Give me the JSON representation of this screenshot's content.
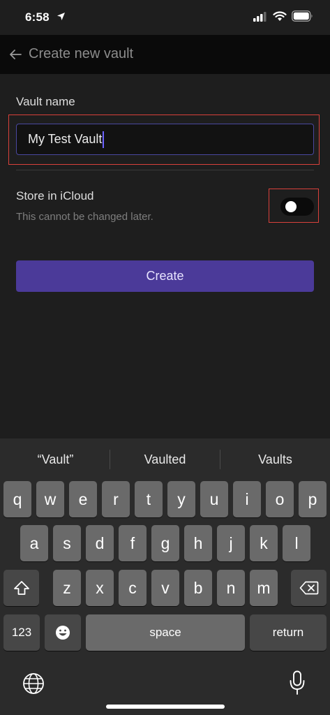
{
  "status_bar": {
    "time": "6:58"
  },
  "header": {
    "title": "Create new vault"
  },
  "form": {
    "vault_name_label": "Vault name",
    "vault_name_value": "My Test Vault",
    "icloud_label": "Store in iCloud",
    "icloud_sub": "This cannot be changed later.",
    "icloud_enabled": false,
    "create_label": "Create"
  },
  "keyboard": {
    "suggestions": [
      "“Vault”",
      "Vaulted",
      "Vaults"
    ],
    "row1": [
      "q",
      "w",
      "e",
      "r",
      "t",
      "y",
      "u",
      "i",
      "o",
      "p"
    ],
    "row2": [
      "a",
      "s",
      "d",
      "f",
      "g",
      "h",
      "j",
      "k",
      "l"
    ],
    "row3": [
      "z",
      "x",
      "c",
      "v",
      "b",
      "n",
      "m"
    ],
    "numbers_label": "123",
    "space_label": "space",
    "return_label": "return"
  },
  "colors": {
    "accent": "#4b3a99",
    "highlight_box": "#d9413b",
    "input_border": "#4a48a0"
  }
}
